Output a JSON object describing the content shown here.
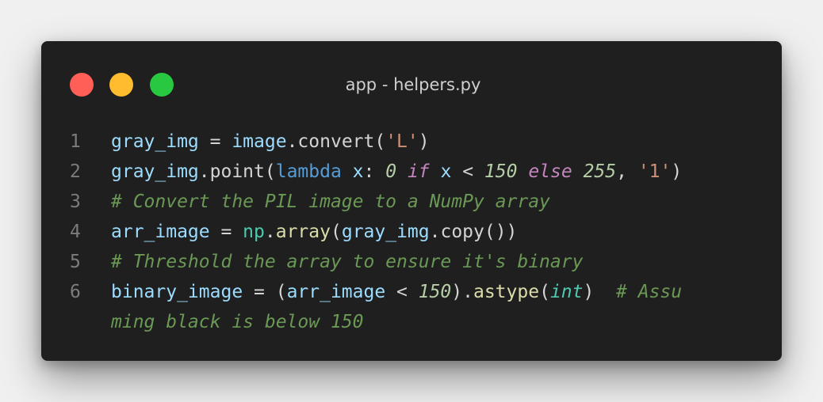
{
  "window": {
    "title": "app - helpers.py",
    "buttons": {
      "close": "close",
      "minimize": "minimize",
      "maximize": "maximize"
    }
  },
  "code": {
    "lines": [
      {
        "number": "1",
        "tokens": [
          {
            "t": "gray_img",
            "c": "var"
          },
          {
            "t": " = ",
            "c": "op"
          },
          {
            "t": "image",
            "c": "var"
          },
          {
            "t": ".convert(",
            "c": "op"
          },
          {
            "t": "'L'",
            "c": "str"
          },
          {
            "t": ")",
            "c": "op"
          }
        ]
      },
      {
        "number": "2",
        "tokens": [
          {
            "t": "gray_img",
            "c": "var"
          },
          {
            "t": ".point(",
            "c": "op"
          },
          {
            "t": "lambda",
            "c": "kw"
          },
          {
            "t": " ",
            "c": "op"
          },
          {
            "t": "x",
            "c": "var"
          },
          {
            "t": ": ",
            "c": "op"
          },
          {
            "t": "0",
            "c": "num"
          },
          {
            "t": " ",
            "c": "op"
          },
          {
            "t": "if",
            "c": "ctrl"
          },
          {
            "t": " ",
            "c": "op"
          },
          {
            "t": "x",
            "c": "var"
          },
          {
            "t": " < ",
            "c": "op"
          },
          {
            "t": "150",
            "c": "num"
          },
          {
            "t": " ",
            "c": "op"
          },
          {
            "t": "else",
            "c": "ctrl"
          },
          {
            "t": " ",
            "c": "op"
          },
          {
            "t": "255",
            "c": "num"
          },
          {
            "t": ", ",
            "c": "op"
          },
          {
            "t": "'1'",
            "c": "str"
          },
          {
            "t": ")",
            "c": "op"
          }
        ]
      },
      {
        "number": "3",
        "tokens": [
          {
            "t": "# Convert the PIL image to a NumPy array",
            "c": "cmt"
          }
        ]
      },
      {
        "number": "4",
        "tokens": [
          {
            "t": "arr_image",
            "c": "var"
          },
          {
            "t": " = ",
            "c": "op"
          },
          {
            "t": "np",
            "c": "mod"
          },
          {
            "t": ".",
            "c": "op"
          },
          {
            "t": "array",
            "c": "fn"
          },
          {
            "t": "(",
            "c": "op"
          },
          {
            "t": "gray_img",
            "c": "var"
          },
          {
            "t": ".copy())",
            "c": "op"
          }
        ]
      },
      {
        "number": "5",
        "tokens": [
          {
            "t": "# Threshold the array to ensure it's binary",
            "c": "cmt"
          }
        ]
      },
      {
        "number": "6",
        "tokens": [
          {
            "t": "binary_image",
            "c": "var"
          },
          {
            "t": " = (",
            "c": "op"
          },
          {
            "t": "arr_image",
            "c": "var"
          },
          {
            "t": " < ",
            "c": "op"
          },
          {
            "t": "150",
            "c": "num"
          },
          {
            "t": ").",
            "c": "op"
          },
          {
            "t": "astype",
            "c": "fn"
          },
          {
            "t": "(",
            "c": "op"
          },
          {
            "t": "int",
            "c": "type"
          },
          {
            "t": ")  ",
            "c": "op"
          },
          {
            "t": "# Assu",
            "c": "cmt"
          }
        ]
      },
      {
        "number": "",
        "tokens": [
          {
            "t": "ming black is below 150",
            "c": "cmt"
          }
        ]
      }
    ]
  }
}
